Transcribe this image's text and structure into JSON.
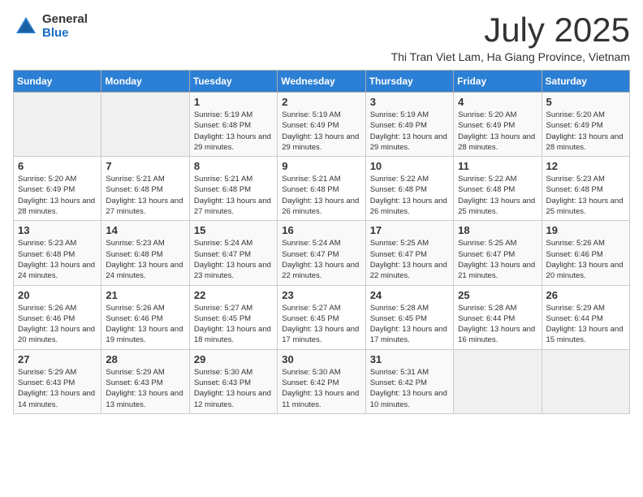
{
  "logo": {
    "general": "General",
    "blue": "Blue"
  },
  "title": "July 2025",
  "subtitle": "Thi Tran Viet Lam, Ha Giang Province, Vietnam",
  "days_of_week": [
    "Sunday",
    "Monday",
    "Tuesday",
    "Wednesday",
    "Thursday",
    "Friday",
    "Saturday"
  ],
  "weeks": [
    [
      {
        "day": "",
        "info": ""
      },
      {
        "day": "",
        "info": ""
      },
      {
        "day": "1",
        "info": "Sunrise: 5:19 AM\nSunset: 6:48 PM\nDaylight: 13 hours and 29 minutes."
      },
      {
        "day": "2",
        "info": "Sunrise: 5:19 AM\nSunset: 6:49 PM\nDaylight: 13 hours and 29 minutes."
      },
      {
        "day": "3",
        "info": "Sunrise: 5:19 AM\nSunset: 6:49 PM\nDaylight: 13 hours and 29 minutes."
      },
      {
        "day": "4",
        "info": "Sunrise: 5:20 AM\nSunset: 6:49 PM\nDaylight: 13 hours and 28 minutes."
      },
      {
        "day": "5",
        "info": "Sunrise: 5:20 AM\nSunset: 6:49 PM\nDaylight: 13 hours and 28 minutes."
      }
    ],
    [
      {
        "day": "6",
        "info": "Sunrise: 5:20 AM\nSunset: 6:49 PM\nDaylight: 13 hours and 28 minutes."
      },
      {
        "day": "7",
        "info": "Sunrise: 5:21 AM\nSunset: 6:48 PM\nDaylight: 13 hours and 27 minutes."
      },
      {
        "day": "8",
        "info": "Sunrise: 5:21 AM\nSunset: 6:48 PM\nDaylight: 13 hours and 27 minutes."
      },
      {
        "day": "9",
        "info": "Sunrise: 5:21 AM\nSunset: 6:48 PM\nDaylight: 13 hours and 26 minutes."
      },
      {
        "day": "10",
        "info": "Sunrise: 5:22 AM\nSunset: 6:48 PM\nDaylight: 13 hours and 26 minutes."
      },
      {
        "day": "11",
        "info": "Sunrise: 5:22 AM\nSunset: 6:48 PM\nDaylight: 13 hours and 25 minutes."
      },
      {
        "day": "12",
        "info": "Sunrise: 5:23 AM\nSunset: 6:48 PM\nDaylight: 13 hours and 25 minutes."
      }
    ],
    [
      {
        "day": "13",
        "info": "Sunrise: 5:23 AM\nSunset: 6:48 PM\nDaylight: 13 hours and 24 minutes."
      },
      {
        "day": "14",
        "info": "Sunrise: 5:23 AM\nSunset: 6:48 PM\nDaylight: 13 hours and 24 minutes."
      },
      {
        "day": "15",
        "info": "Sunrise: 5:24 AM\nSunset: 6:47 PM\nDaylight: 13 hours and 23 minutes."
      },
      {
        "day": "16",
        "info": "Sunrise: 5:24 AM\nSunset: 6:47 PM\nDaylight: 13 hours and 22 minutes."
      },
      {
        "day": "17",
        "info": "Sunrise: 5:25 AM\nSunset: 6:47 PM\nDaylight: 13 hours and 22 minutes."
      },
      {
        "day": "18",
        "info": "Sunrise: 5:25 AM\nSunset: 6:47 PM\nDaylight: 13 hours and 21 minutes."
      },
      {
        "day": "19",
        "info": "Sunrise: 5:26 AM\nSunset: 6:46 PM\nDaylight: 13 hours and 20 minutes."
      }
    ],
    [
      {
        "day": "20",
        "info": "Sunrise: 5:26 AM\nSunset: 6:46 PM\nDaylight: 13 hours and 20 minutes."
      },
      {
        "day": "21",
        "info": "Sunrise: 5:26 AM\nSunset: 6:46 PM\nDaylight: 13 hours and 19 minutes."
      },
      {
        "day": "22",
        "info": "Sunrise: 5:27 AM\nSunset: 6:45 PM\nDaylight: 13 hours and 18 minutes."
      },
      {
        "day": "23",
        "info": "Sunrise: 5:27 AM\nSunset: 6:45 PM\nDaylight: 13 hours and 17 minutes."
      },
      {
        "day": "24",
        "info": "Sunrise: 5:28 AM\nSunset: 6:45 PM\nDaylight: 13 hours and 17 minutes."
      },
      {
        "day": "25",
        "info": "Sunrise: 5:28 AM\nSunset: 6:44 PM\nDaylight: 13 hours and 16 minutes."
      },
      {
        "day": "26",
        "info": "Sunrise: 5:29 AM\nSunset: 6:44 PM\nDaylight: 13 hours and 15 minutes."
      }
    ],
    [
      {
        "day": "27",
        "info": "Sunrise: 5:29 AM\nSunset: 6:43 PM\nDaylight: 13 hours and 14 minutes."
      },
      {
        "day": "28",
        "info": "Sunrise: 5:29 AM\nSunset: 6:43 PM\nDaylight: 13 hours and 13 minutes."
      },
      {
        "day": "29",
        "info": "Sunrise: 5:30 AM\nSunset: 6:43 PM\nDaylight: 13 hours and 12 minutes."
      },
      {
        "day": "30",
        "info": "Sunrise: 5:30 AM\nSunset: 6:42 PM\nDaylight: 13 hours and 11 minutes."
      },
      {
        "day": "31",
        "info": "Sunrise: 5:31 AM\nSunset: 6:42 PM\nDaylight: 13 hours and 10 minutes."
      },
      {
        "day": "",
        "info": ""
      },
      {
        "day": "",
        "info": ""
      }
    ]
  ]
}
